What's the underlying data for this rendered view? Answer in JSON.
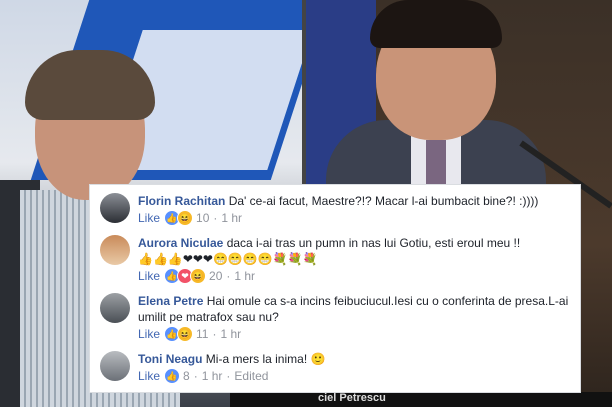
{
  "comments": [
    {
      "name": "Florin Rachitan",
      "text": "Da' ce-ai facut, Maestre?!? Macar l-ai bumbacit bine?! :))))",
      "like": "Like",
      "count": "10",
      "time": "1 hr"
    },
    {
      "name": "Aurora Niculae",
      "text": "daca i-ai tras un pumn in nas lui Gotiu, esti eroul meu !!",
      "emoji_line": "👍👍👍❤❤❤😁😁😁😁💐💐💐",
      "like": "Like",
      "count": "20",
      "time": "1 hr"
    },
    {
      "name": "Elena Petre",
      "text": "Hai omule ca s-a incins feibuciucul.Iesi cu o conferinta de presa.L-ai umilit pe matrafox sau nu?",
      "like": "Like",
      "count": "11",
      "time": "1 hr"
    },
    {
      "name": "Toni Neagu",
      "text": "Mi-a mers la inima!",
      "emoji": "🙂",
      "like": "Like",
      "count": "8",
      "time": "1 hr",
      "edited": "Edited"
    }
  ],
  "caption": "ciel Petrescu",
  "colors": {
    "link": "#365899",
    "like": "#4267b2",
    "meta": "#90949c"
  },
  "separator": "·"
}
